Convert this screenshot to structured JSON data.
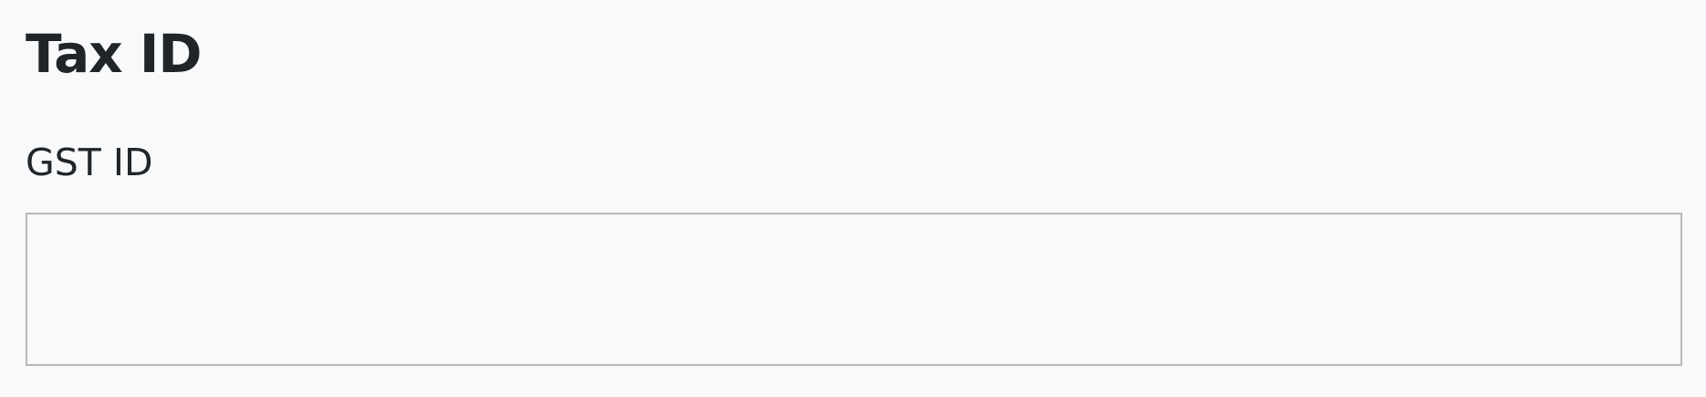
{
  "section": {
    "title": "Tax ID",
    "gst": {
      "label": "GST ID",
      "value": "",
      "placeholder": ""
    }
  }
}
